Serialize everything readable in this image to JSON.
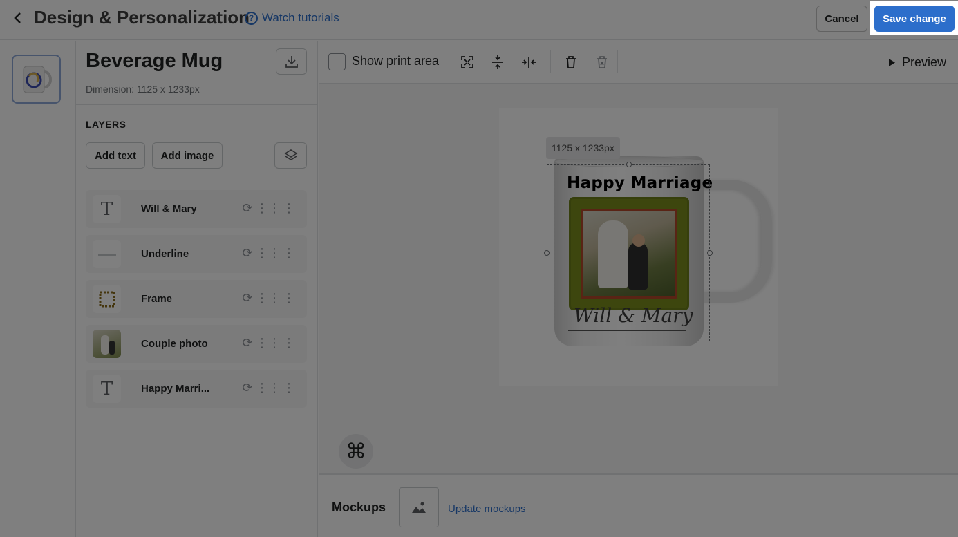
{
  "header": {
    "title": "Design & Personalization",
    "tutorial_label": "Watch tutorials",
    "cancel_label": "Cancel",
    "save_label": "Save change"
  },
  "product": {
    "name": "Beverage Mug",
    "dimension": "Dimension: 1125 x 1233px"
  },
  "layers": {
    "heading": "LAYERS",
    "add_text_label": "Add text",
    "add_image_label": "Add image",
    "items": [
      {
        "name": "Will & Mary",
        "kind": "text-icon"
      },
      {
        "name": "Underline",
        "kind": "image-icon"
      },
      {
        "name": "Frame",
        "kind": "image-icon"
      },
      {
        "name": "Couple photo",
        "kind": "image-icon"
      },
      {
        "name": "Happy Marri...",
        "kind": "text-icon"
      }
    ]
  },
  "toolbar": {
    "show_print_area_label": "Show print area",
    "preview_label": "Preview"
  },
  "canvas": {
    "dimension_chip": "1125 x 1233px",
    "mug_title": "Happy Marriage",
    "mug_names": "Will & Mary"
  },
  "mockups": {
    "label": "Mockups",
    "update_label": "Update mockups"
  },
  "colors": {
    "accent": "#2c6ecb",
    "overlay": "rgba(0,0,0,0.5)"
  }
}
